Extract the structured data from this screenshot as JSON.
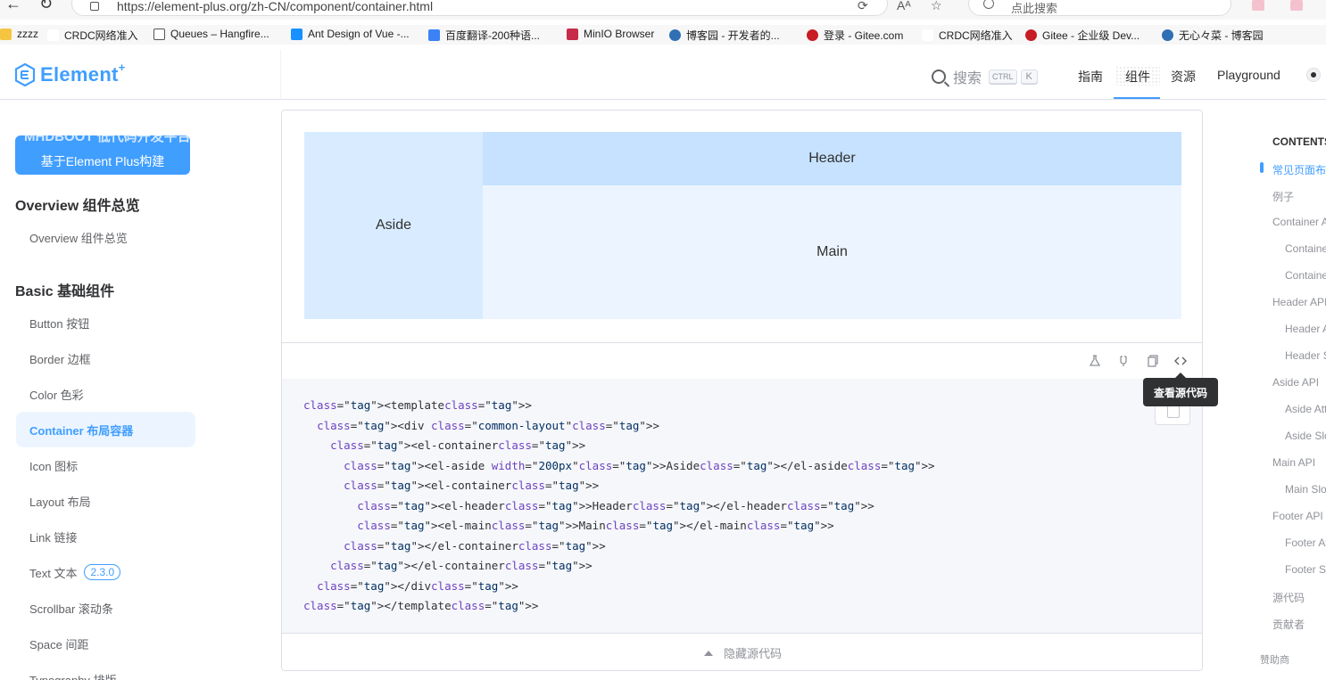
{
  "browser": {
    "url": "https://element-plus.org/zh-CN/component/container.html",
    "search_placeholder": "点此搜索",
    "bookmarks": [
      "zzzz",
      "CRDC网络准入",
      "Queues – Hangfire...",
      "Ant Design of Vue -...",
      "百度翻译-200种语...",
      "MinIO Browser",
      "博客园 - 开发者的...",
      "登录 - Gitee.com",
      "CRDC网络准入",
      "Gitee - 企业级 Dev...",
      "无心々菜 - 博客园"
    ]
  },
  "header": {
    "logo_text": "Element",
    "logo_sup": "+",
    "search_label": "搜索",
    "kbd_ctrl": "CTRL",
    "kbd_k": "K",
    "nav": [
      "指南",
      "组件",
      "资源",
      "Playground"
    ],
    "active_nav": "组件"
  },
  "sidebar": {
    "promo_cut": "MHDBOOT 低代码开发平台",
    "promo_text": "基于Element Plus构建",
    "groups": [
      {
        "title": "Overview 组件总览",
        "items": [
          "Overview 组件总览"
        ]
      },
      {
        "title": "Basic 基础组件",
        "items": [
          "Button 按钮",
          "Border 边框",
          "Color 色彩",
          "Container 布局容器",
          "Icon 图标",
          "Layout 布局",
          "Link 链接",
          "Text 文本",
          "Scrollbar 滚动条",
          "Space 间距",
          "Typography 排版"
        ]
      }
    ],
    "active_item": "Container 布局容器",
    "text_badge": "2.3.0"
  },
  "demo": {
    "aside": "Aside",
    "header": "Header",
    "main": "Main"
  },
  "code": {
    "lines": [
      "<template>",
      "  <div class=\"common-layout\">",
      "    <el-container>",
      "      <el-aside width=\"200px\">Aside</el-aside>",
      "      <el-container>",
      "        <el-header>Header</el-header>",
      "        <el-main>Main</el-main>",
      "      </el-container>",
      "    </el-container>",
      "  </div>",
      "</template>"
    ]
  },
  "tooltip": "查看源代码",
  "hide_code_label": "隐藏源代码",
  "toc": {
    "title": "CONTENTS",
    "items": [
      {
        "label": "常见页面布局",
        "indent": 0,
        "active": true
      },
      {
        "label": "例子",
        "indent": 0
      },
      {
        "label": "Container API",
        "indent": 0
      },
      {
        "label": "Container Attributes",
        "indent": 1
      },
      {
        "label": "Container Slots",
        "indent": 1
      },
      {
        "label": "Header API",
        "indent": 0
      },
      {
        "label": "Header Attributes",
        "indent": 1
      },
      {
        "label": "Header Slots",
        "indent": 1
      },
      {
        "label": "Aside API",
        "indent": 0
      },
      {
        "label": "Aside Attributes",
        "indent": 1
      },
      {
        "label": "Aside Slots",
        "indent": 1
      },
      {
        "label": "Main API",
        "indent": 0
      },
      {
        "label": "Main Slots",
        "indent": 1
      },
      {
        "label": "Footer API",
        "indent": 0
      },
      {
        "label": "Footer Attributes",
        "indent": 1
      },
      {
        "label": "Footer Slots",
        "indent": 1
      },
      {
        "label": "源代码",
        "indent": 0
      },
      {
        "label": "贡献者",
        "indent": 0
      }
    ],
    "sponsor": "赞助商"
  },
  "colors": {
    "accent": "#409eff",
    "aside_bg": "#d9ecff",
    "header_bg": "#c6e2ff",
    "main_bg": "#ecf5ff"
  }
}
